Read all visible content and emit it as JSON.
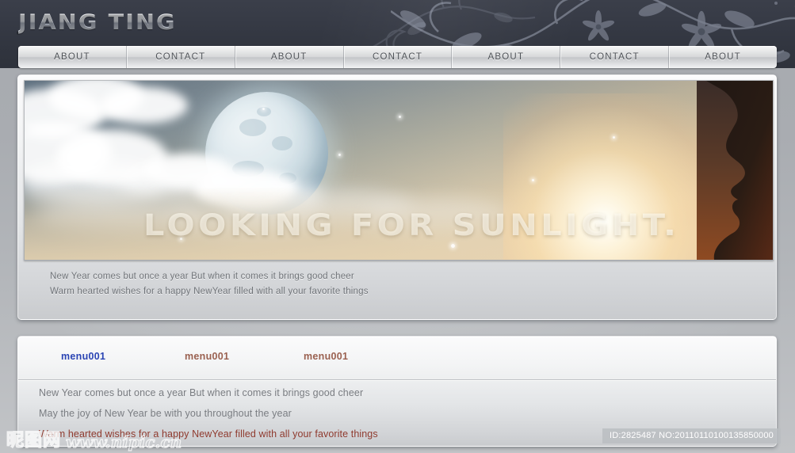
{
  "site": {
    "logo": "JIANG TING"
  },
  "nav": {
    "items": [
      {
        "label": "ABOUT"
      },
      {
        "label": "CONTACT"
      },
      {
        "label": "ABOUT"
      },
      {
        "label": "CONTACT"
      },
      {
        "label": "ABOUT"
      },
      {
        "label": "CONTACT"
      },
      {
        "label": "ABOUT"
      }
    ]
  },
  "hero": {
    "title": "LOOKING  FOR  SUNLIGHT.",
    "caption": [
      "New Year comes but once a year But when it comes it brings good cheer",
      "Warm hearted wishes for a happy NewYear filled with all your favorite things"
    ]
  },
  "content": {
    "menu_links": [
      {
        "label": "menu001",
        "color": "#2b45b4"
      },
      {
        "label": "menu001",
        "color": "#9a6150"
      },
      {
        "label": "menu001",
        "color": "#9a6150"
      }
    ],
    "paragraphs": [
      {
        "text": "New Year comes but once a year But when it comes it brings good cheer",
        "color": "#7a7d82"
      },
      {
        "text": "May the joy of New Year be with you throughout the year",
        "color": "#7a7d82"
      },
      {
        "text": "Warm hearted wishes for a happy NewYear filled with all your favorite things",
        "color": "#8f3a2e"
      }
    ]
  },
  "watermark": {
    "cn": "昵图网",
    "url": "www.nipic.cn"
  },
  "footer": {
    "id_text": "ID:2825487 NO:20110110100135850000"
  },
  "colors": {
    "header_dark": "#363a45",
    "nav_text": "#4e5257",
    "accent_blue": "#2b45b4",
    "accent_brown": "#9a6150",
    "accent_red": "#8f3a2e"
  }
}
